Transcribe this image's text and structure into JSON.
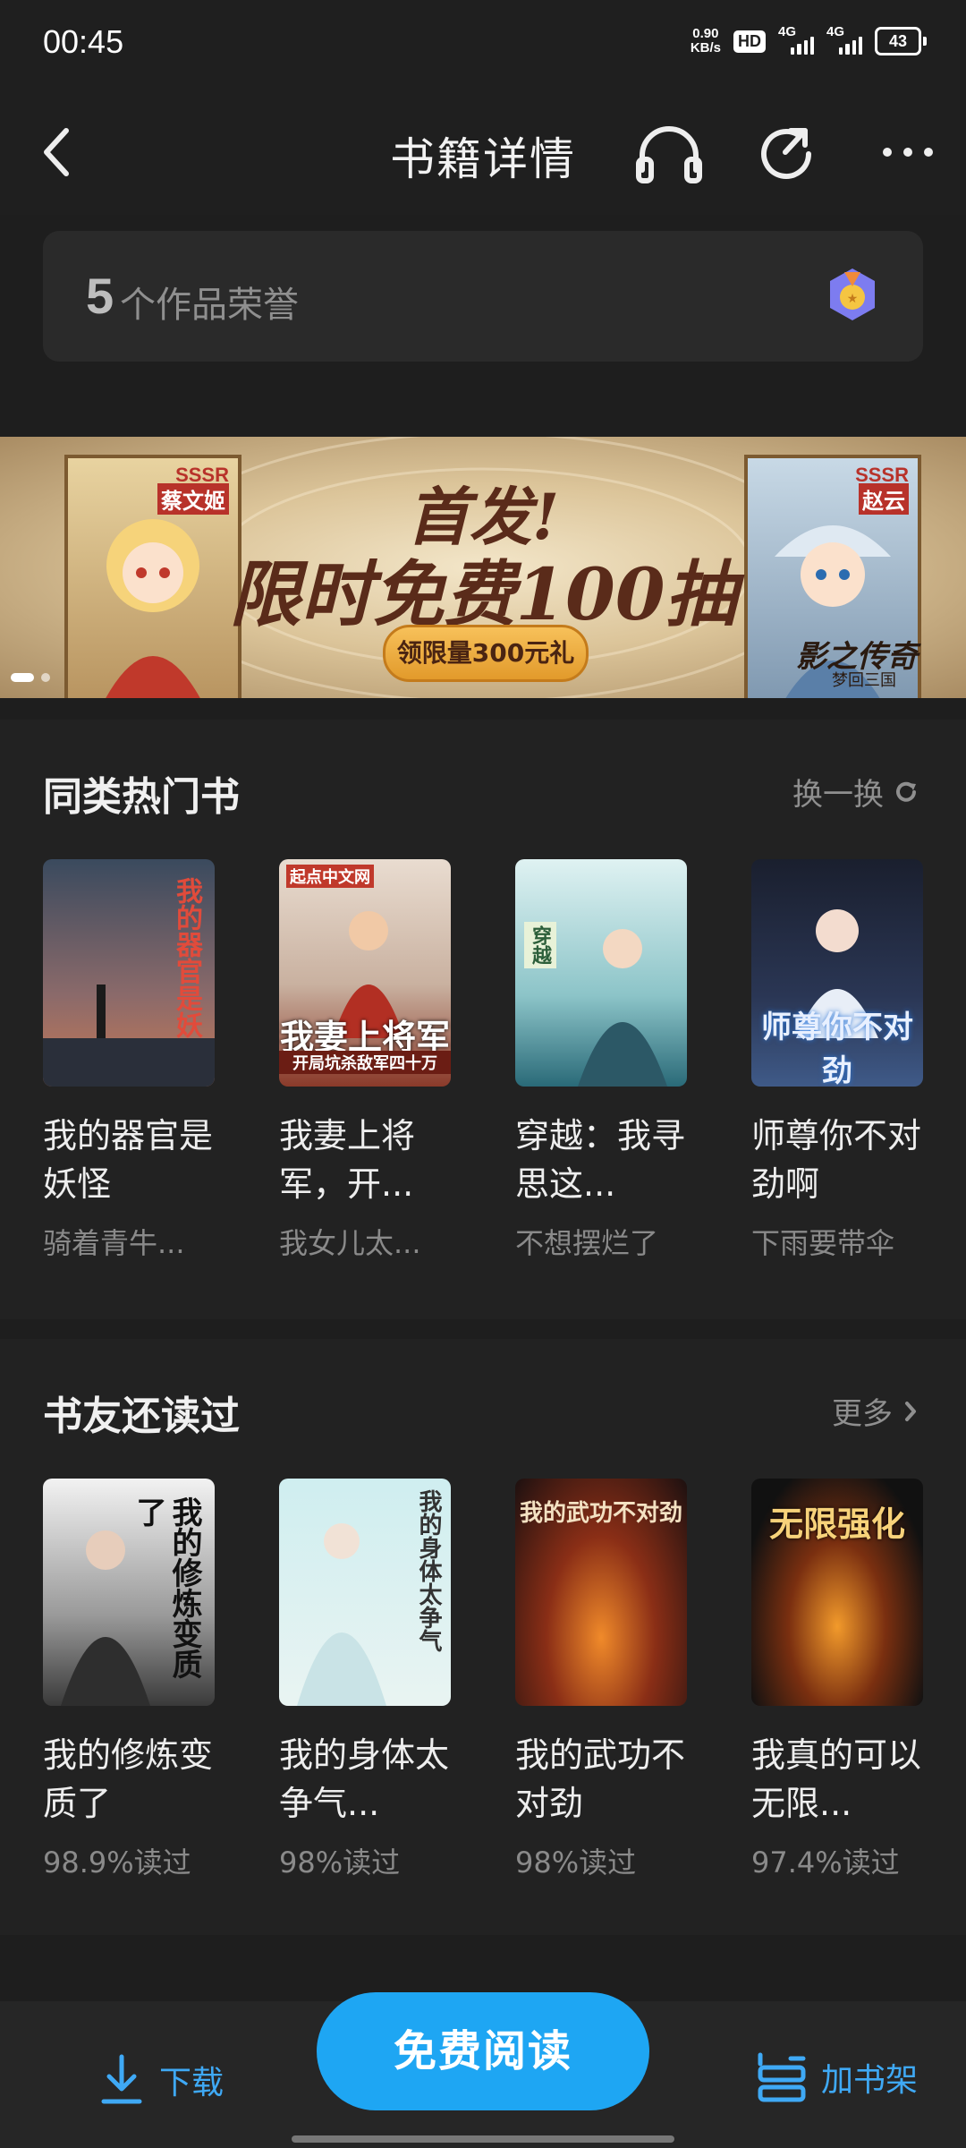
{
  "status_bar": {
    "time": "00:45",
    "net_speed_value": "0.90",
    "net_speed_unit": "KB/s",
    "hd_label": "HD",
    "network_1": "4G",
    "network_2": "4G",
    "battery": "43"
  },
  "nav": {
    "title": "书籍详情",
    "back_icon": "back-chevron-icon",
    "listen_icon": "headphones-icon",
    "share_icon": "share-icon",
    "more_icon": "more-icon"
  },
  "honors": {
    "count": "5",
    "label": "个作品荣誉"
  },
  "banner": {
    "headline": "首发!",
    "subline": "限时免费100抽",
    "button": "领限量300元礼",
    "left_tag": "SSSR",
    "left_name": "蔡文姬",
    "right_tag": "SSSR",
    "right_name": "赵云",
    "brand": "影之传奇",
    "brand_sub": "梦回三国",
    "dot_count": 2,
    "active_dot": 0
  },
  "similar_books": {
    "title": "同类热门书",
    "action": "换一换",
    "items": [
      {
        "title": "我的器官是妖怪",
        "meta": "骑着青牛...",
        "cover_text": "我的器官是妖怪",
        "cover_color_top": "#3a4a5e",
        "cover_color_bottom": "#c97955"
      },
      {
        "title": "我妻上将军，开...",
        "meta": "我女儿太...",
        "cover_text": "我妻上将军",
        "cover_badge": "起点中文网",
        "cover_strap": "开局坑杀敌军四十万",
        "cover_color_top": "#e9dcd0",
        "cover_color_bottom": "#8a3a2a"
      },
      {
        "title": "穿越：我寻思这...",
        "meta": "不想摆烂了",
        "cover_text": "穿越",
        "cover_color_top": "#dff2f2",
        "cover_color_bottom": "#2a6a78"
      },
      {
        "title": "师尊你不对劲啊",
        "meta": "下雨要带伞",
        "cover_text": "师尊你不对劲",
        "cover_color_top": "#1a1f2e",
        "cover_color_bottom": "#3f5a88"
      }
    ]
  },
  "also_read": {
    "title": "书友还读过",
    "action": "更多",
    "items": [
      {
        "title": "我的修炼变质了",
        "meta": "98.9%读过",
        "cover_text": "我的修炼变质了",
        "cover_color_top": "#f2f2f2",
        "cover_color_bottom": "#3a3a3a"
      },
      {
        "title": "我的身体太争气...",
        "meta": "98%读过",
        "cover_text": "我的身体太争气",
        "cover_color_top": "#cfeef0",
        "cover_color_bottom": "#e9f4f2"
      },
      {
        "title": "我的武功不对劲",
        "meta": "98%读过",
        "cover_text": "我的武功不对劲",
        "cover_color_top": "#1c1010",
        "cover_color_bottom": "#c2531e"
      },
      {
        "title": "我真的可以无限...",
        "meta": "97.4%读过",
        "cover_text": "无限强化",
        "cover_color_top": "#111",
        "cover_color_bottom": "#b5531a"
      }
    ]
  },
  "bottom_bar": {
    "download": "下载",
    "read": "免费阅读",
    "add_shelf": "加书架"
  },
  "colors": {
    "accent": "#1ea6f3",
    "bg": "#1e1e1e"
  }
}
